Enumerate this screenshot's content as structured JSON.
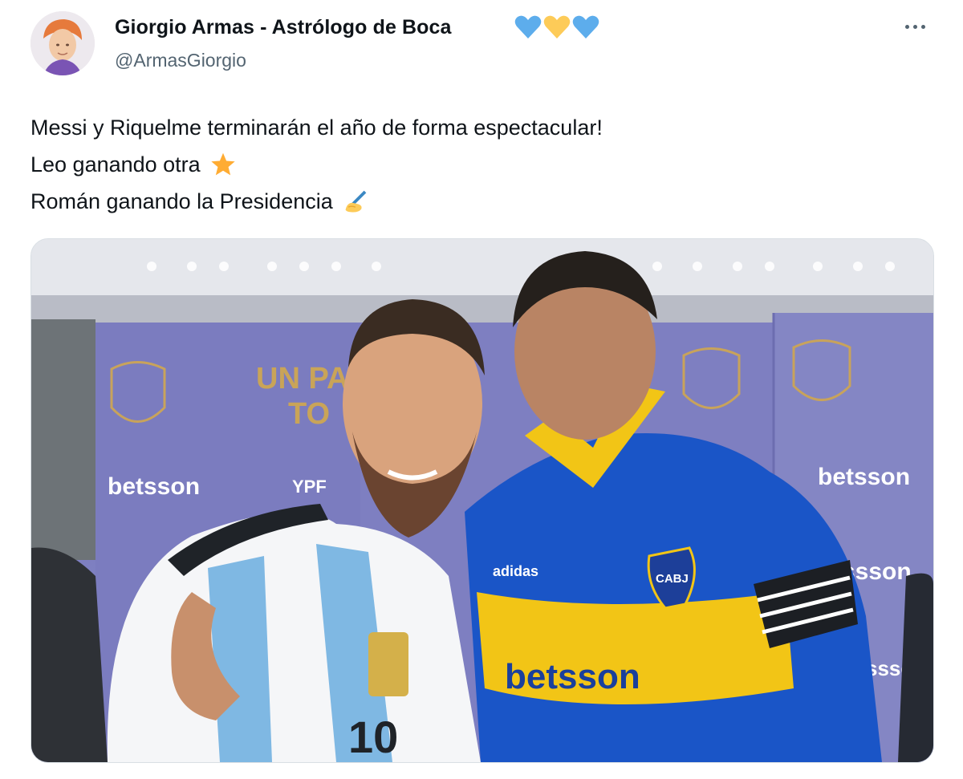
{
  "tweet": {
    "author": {
      "name": "Giorgio Armas - Astrólogo de Boca",
      "name_emojis": [
        "blue-heart",
        "yellow-heart",
        "blue-heart"
      ],
      "handle": "@ArmasGiorgio"
    },
    "more_label": "···",
    "lines": [
      {
        "text": "Messi y Riquelme terminarán el año de forma espectacular!",
        "emoji": ""
      },
      {
        "text": "Leo ganando otra",
        "emoji": "star"
      },
      {
        "text": "Román ganando la Presidencia",
        "emoji": "writing-hand"
      }
    ]
  },
  "media": {
    "alt": "photo",
    "backdrop_text": {
      "slogan_line1": "UN PA",
      "slogan_line2": "TO",
      "sponsor1": "betsson",
      "sponsor2": "YPF",
      "sponsor3": "betsson",
      "sponsor4": "ssson",
      "sponsor5": "ssson"
    },
    "jersey_text": {
      "boca_sponsor": "betsson",
      "boca_crest": "CABJ",
      "boca_brand": "adidas",
      "messi_number": "10"
    }
  },
  "colors": {
    "name_text": "#0f1419",
    "handle_text": "#536471",
    "blue_heart": "#5dadec",
    "yellow_heart": "#fdcb58",
    "boca_blue": "#1a55c7",
    "boca_yellow": "#f2c516",
    "backdrop_purple": "#7e7fc1"
  },
  "icons": {
    "more": "ellipsis-icon",
    "star": "star-emoji-icon",
    "writing": "writing-hand-emoji-icon"
  }
}
